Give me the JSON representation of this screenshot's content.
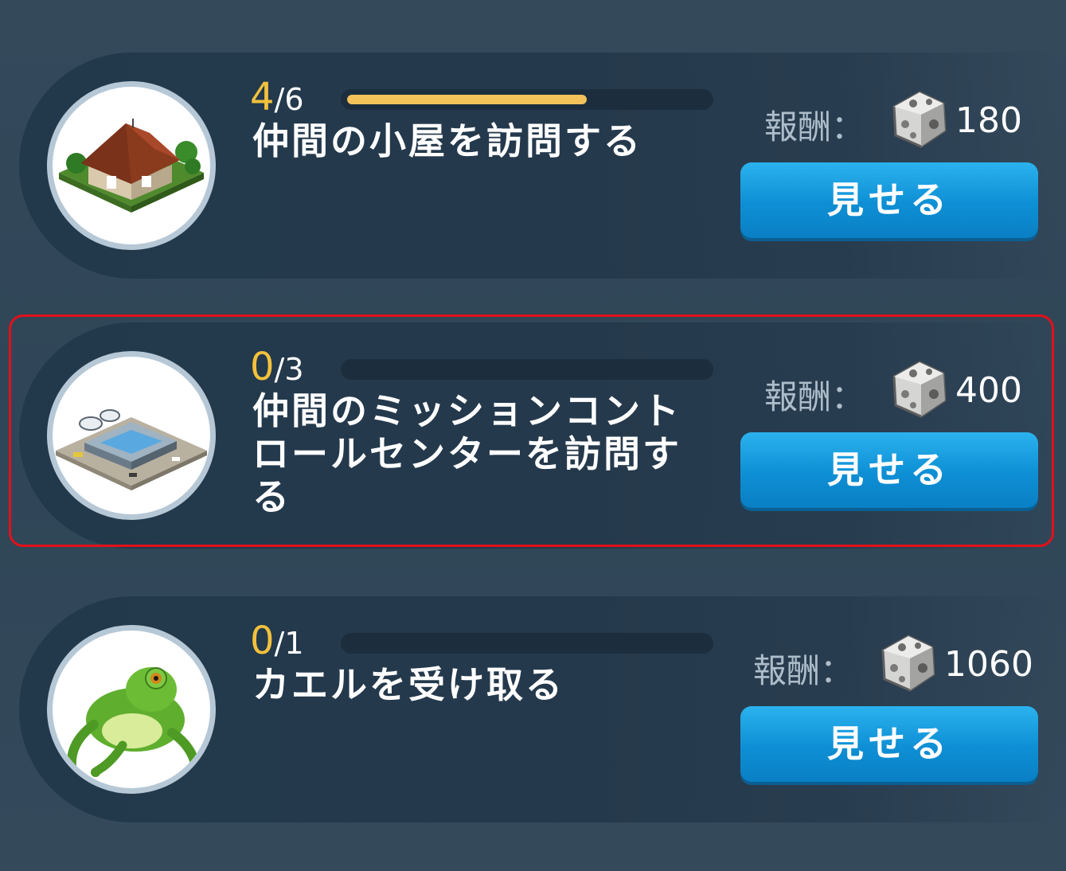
{
  "colors": {
    "accent_progress": "#f3c25a",
    "current_count": "#f3c13c",
    "button": "#0e8fd5",
    "highlight": "#e3101a"
  },
  "quests": [
    {
      "icon": "house-building-icon",
      "current": "4",
      "total": "/6",
      "progress": 0.667,
      "title": "仲間の小屋を訪問する",
      "reward_label": "報酬：",
      "reward_icon": "stone-resource-icon",
      "reward_value": "180",
      "button_label": "見せる"
    },
    {
      "icon": "mission-control-center-icon",
      "current": "0",
      "total": "/3",
      "progress": 0,
      "title": "仲間のミッションコントロールセンターを訪問する",
      "reward_label": "報酬：",
      "reward_icon": "stone-resource-icon",
      "reward_value": "400",
      "button_label": "見せる",
      "highlighted": true
    },
    {
      "icon": "frog-icon",
      "current": "0",
      "total": "/1",
      "progress": 0,
      "title": "カエルを受け取る",
      "reward_label": "報酬：",
      "reward_icon": "stone-resource-icon",
      "reward_value": "1060",
      "button_label": "見せる"
    }
  ]
}
